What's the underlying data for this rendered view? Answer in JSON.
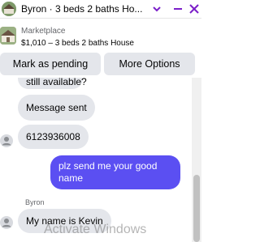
{
  "header": {
    "title": "Byron · 3 beds 2 baths Ho...",
    "avatar_icon": "house-photo"
  },
  "listing": {
    "label": "Marketplace",
    "detail": "$1,010 – 3 beds 2 baths House",
    "thumbnail_icon": "house-photo"
  },
  "actions": {
    "pending_label": "Mark as pending",
    "more_label": "More Options"
  },
  "messages": [
    {
      "from": "other",
      "text": "still available?"
    },
    {
      "from": "other",
      "text": "Message sent"
    },
    {
      "from": "other",
      "text": "6123936008"
    },
    {
      "from": "me",
      "text": "plz send me your good name"
    },
    {
      "from": "other",
      "text": "My name is Kevin"
    }
  ],
  "sender_name": "Byron",
  "watermark": "Activate Windows",
  "colors": {
    "accent": "#7b1fc9",
    "outgoing_bubble": "#5b4ff2",
    "incoming_bubble": "#e4e6eb"
  }
}
